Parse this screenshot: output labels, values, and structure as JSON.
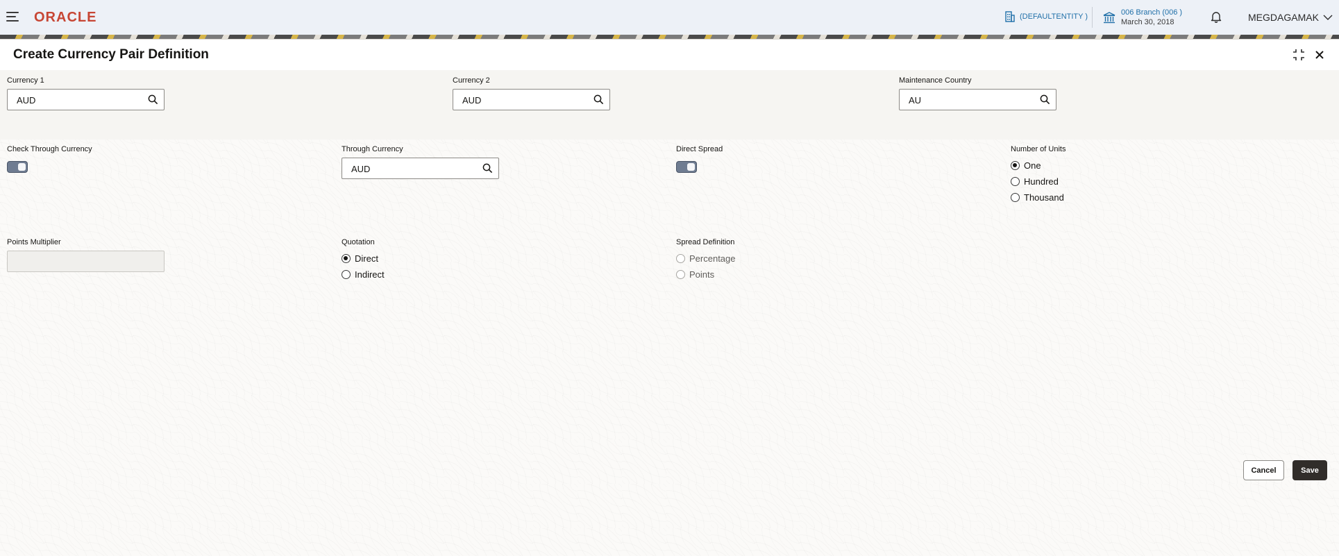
{
  "header": {
    "logo_text": "ORACLE",
    "entity": "(DEFAULTENTITY )",
    "branch_name": "006 Branch (006 )",
    "branch_date": "March 30, 2018",
    "user": "MEGDAGAMAK"
  },
  "modal": {
    "title": "Create Currency Pair Definition"
  },
  "form": {
    "currency1": {
      "label": "Currency 1",
      "value": "AUD"
    },
    "currency2": {
      "label": "Currency 2",
      "value": "AUD"
    },
    "maintenance_country": {
      "label": "Maintenance Country",
      "value": "AU"
    },
    "check_through_currency": {
      "label": "Check Through Currency",
      "on": true
    },
    "through_currency": {
      "label": "Through Currency",
      "value": "AUD"
    },
    "direct_spread": {
      "label": "Direct Spread",
      "on": true
    },
    "number_of_units": {
      "label": "Number of Units",
      "options": [
        "One",
        "Hundred",
        "Thousand"
      ],
      "selected": "One"
    },
    "points_multiplier": {
      "label": "Points Multiplier",
      "value": ""
    },
    "quotation": {
      "label": "Quotation",
      "options": [
        "Direct",
        "Indirect"
      ],
      "selected": "Direct"
    },
    "spread_definition": {
      "label": "Spread Definition",
      "options": [
        "Percentage",
        "Points"
      ],
      "selected": ""
    }
  },
  "footer": {
    "cancel_label": "Cancel",
    "save_label": "Save"
  },
  "colors": {
    "brand": "#c74634",
    "link": "#1f6fa8",
    "primary_button": "#312d2a"
  }
}
